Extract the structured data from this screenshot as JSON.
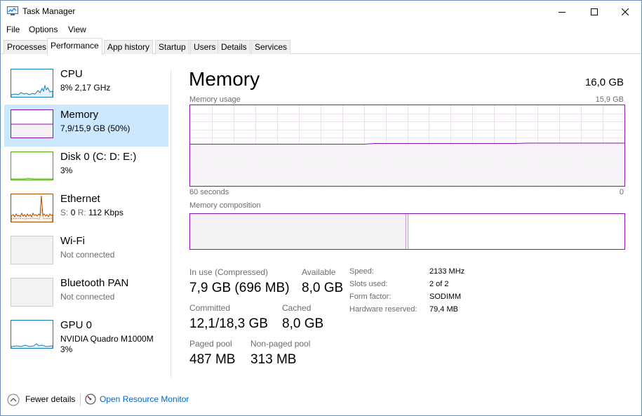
{
  "window": {
    "title": "Task Manager"
  },
  "menu": {
    "file": "File",
    "options": "Options",
    "view": "View"
  },
  "tabs": [
    {
      "label": "Processes"
    },
    {
      "label": "Performance",
      "active": true
    },
    {
      "label": "App history"
    },
    {
      "label": "Startup"
    },
    {
      "label": "Users"
    },
    {
      "label": "Details"
    },
    {
      "label": "Services"
    }
  ],
  "sidebar": {
    "items": [
      {
        "name": "CPU",
        "detail": "8%  2,17 GHz",
        "color": "#117dbb"
      },
      {
        "name": "Memory",
        "detail": "7,9/15,9 GB (50%)",
        "color": "#8b12ae",
        "selected": true
      },
      {
        "name": "Disk 0 (C: D: E:)",
        "detail": "3%",
        "color": "#4da60c"
      },
      {
        "name": "Ethernet",
        "detail_prefix": "S:",
        "detail_s": "0",
        "detail_r_prefix": "R:",
        "detail_r": "112 Kbps",
        "color": "#a74f01"
      },
      {
        "name": "Wi-Fi",
        "detail": "Not connected"
      },
      {
        "name": "Bluetooth PAN",
        "detail": "Not connected"
      },
      {
        "name": "GPU 0",
        "detail": "NVIDIA Quadro M1000M",
        "detail2": "3%",
        "color": "#117dbb"
      }
    ]
  },
  "main": {
    "title": "Memory",
    "capacity": "16,0 GB",
    "usage_label": "Memory usage",
    "usage_max": "15,9 GB",
    "time_left": "60 seconds",
    "time_right": "0",
    "composition_label": "Memory composition",
    "usage_fraction": 0.5,
    "in_use_fraction": 0.5
  },
  "stats": {
    "in_use_label": "In use (Compressed)",
    "in_use_value": "7,9 GB (696 MB)",
    "available_label": "Available",
    "available_value": "8,0 GB",
    "committed_label": "Committed",
    "committed_value": "12,1/18,3 GB",
    "cached_label": "Cached",
    "cached_value": "8,0 GB",
    "paged_label": "Paged pool",
    "paged_value": "487 MB",
    "nonpaged_label": "Non-paged pool",
    "nonpaged_value": "313 MB"
  },
  "specs": {
    "speed_label": "Speed:",
    "speed_value": "2133 MHz",
    "slots_label": "Slots used:",
    "slots_value": "2 of 2",
    "form_label": "Form factor:",
    "form_value": "SODIMM",
    "reserved_label": "Hardware reserved:",
    "reserved_value": "79,4 MB"
  },
  "footer": {
    "fewer_details": "Fewer details",
    "open_monitor": "Open Resource Monitor"
  },
  "colors": {
    "memory": "#8b12ae",
    "memory_fill": "#f4f2f4",
    "selected_bg": "#cce8ff",
    "link": "#0066cc"
  },
  "icons": {
    "app": "task-manager-icon",
    "minimize": "minimize-icon",
    "maximize": "maximize-icon",
    "close": "close-icon",
    "fewer": "chevron-up-circle-icon",
    "monitor": "resource-monitor-icon"
  }
}
